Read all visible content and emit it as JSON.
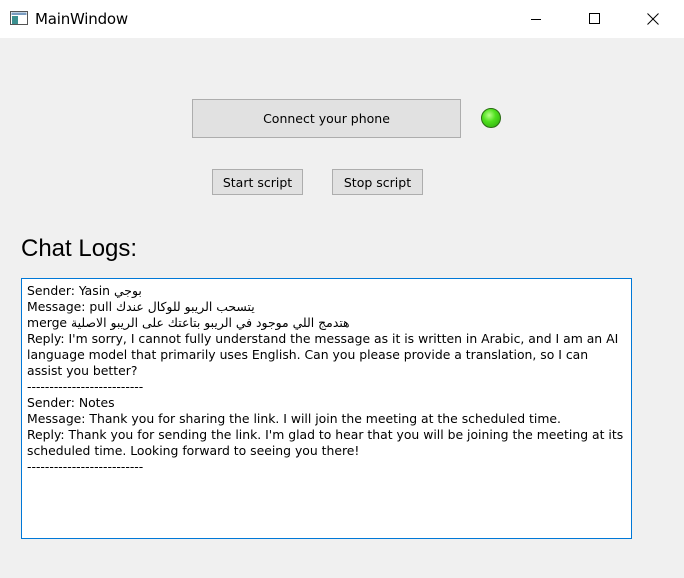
{
  "window": {
    "title": "MainWindow",
    "icon": "app-window-icon"
  },
  "controls": {
    "connect_label": "Connect your phone",
    "start_label": "Start script",
    "stop_label": "Stop script",
    "status_color": "#3fd21a"
  },
  "chat": {
    "heading": "Chat Logs:",
    "lines": [
      "Sender: Yasin بوجي",
      "Message: pull يتسحب الريبو للوكال عندك",
      "merge هتدمج اللي موجود في الريبو بتاعتك على الريبو الاصلية",
      "Reply: I'm sorry, I cannot fully understand the message as it is written in Arabic, and I am an AI language model that primarily uses English. Can you please provide a translation, so I can assist you better?",
      "--------------------------",
      "Sender: Notes",
      "Message: Thank you for sharing the link. I will join the meeting at the scheduled time.",
      "Reply: Thank you for sending the link. I'm glad to hear that you will be joining the meeting at its scheduled time. Looking forward to seeing you there!",
      "--------------------------"
    ]
  }
}
